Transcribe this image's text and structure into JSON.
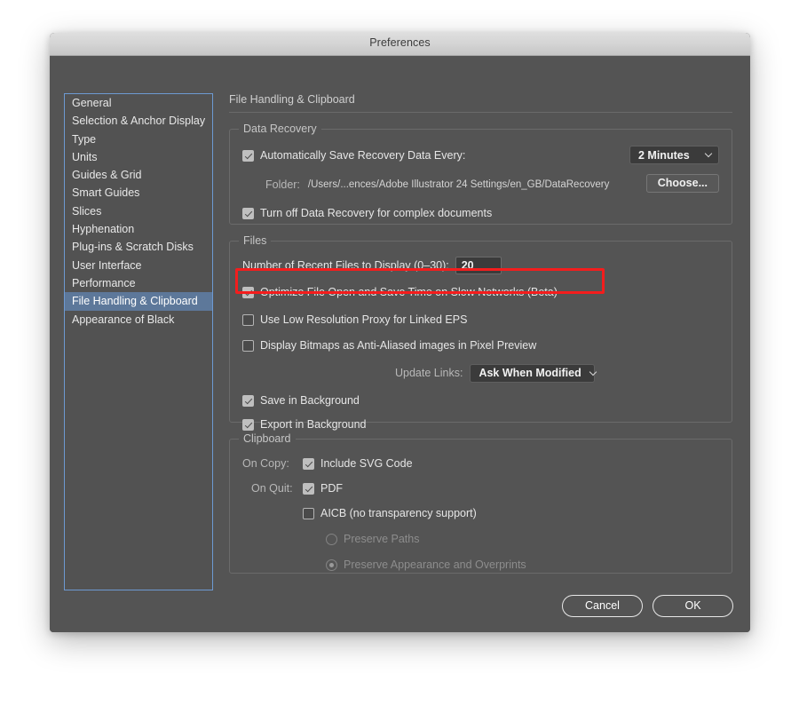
{
  "window": {
    "title": "Preferences"
  },
  "sidebar": {
    "items": [
      {
        "label": "General",
        "selected": false
      },
      {
        "label": "Selection & Anchor Display",
        "selected": false
      },
      {
        "label": "Type",
        "selected": false
      },
      {
        "label": "Units",
        "selected": false
      },
      {
        "label": "Guides & Grid",
        "selected": false
      },
      {
        "label": "Smart Guides",
        "selected": false
      },
      {
        "label": "Slices",
        "selected": false
      },
      {
        "label": "Hyphenation",
        "selected": false
      },
      {
        "label": "Plug-ins & Scratch Disks",
        "selected": false
      },
      {
        "label": "User Interface",
        "selected": false
      },
      {
        "label": "Performance",
        "selected": false
      },
      {
        "label": "File Handling & Clipboard",
        "selected": true
      },
      {
        "label": "Appearance of Black",
        "selected": false
      }
    ]
  },
  "panel": {
    "header": "File Handling & Clipboard",
    "data_recovery": {
      "title": "Data Recovery",
      "auto_save_label": "Automatically Save Recovery Data Every:",
      "auto_save_checked": true,
      "interval_value": "2 Minutes",
      "folder_label": "Folder:",
      "folder_path": "/Users/...ences/Adobe Illustrator 24 Settings/en_GB/DataRecovery",
      "choose_label": "Choose...",
      "turn_off_label": "Turn off Data Recovery for complex documents",
      "turn_off_checked": true
    },
    "files": {
      "title": "Files",
      "recent_files_label": "Number of Recent Files to Display (0–30):",
      "recent_files_value": "20",
      "optimize_label": "Optimize File Open and Save Time on Slow Networks (Beta)",
      "optimize_checked": true,
      "optimize_highlight_color": "#f41d1d",
      "low_res_proxy_label": "Use Low Resolution Proxy for Linked EPS",
      "low_res_proxy_checked": false,
      "bitmaps_label": "Display Bitmaps as Anti-Aliased images in Pixel Preview",
      "bitmaps_checked": false,
      "update_links_label": "Update Links:",
      "update_links_value": "Ask When Modified",
      "save_background_label": "Save in Background",
      "save_background_checked": true,
      "export_background_label": "Export in Background",
      "export_background_checked": true
    },
    "clipboard": {
      "title": "Clipboard",
      "on_copy_label": "On Copy:",
      "include_svg_label": "Include SVG Code",
      "include_svg_checked": true,
      "on_quit_label": "On Quit:",
      "pdf_label": "PDF",
      "pdf_checked": true,
      "aicb_label": "AICB (no transparency support)",
      "aicb_checked": false,
      "preserve_paths_label": "Preserve Paths",
      "preserve_paths_selected": false,
      "preserve_appearance_label": "Preserve Appearance and Overprints",
      "preserve_appearance_selected": true
    }
  },
  "footer": {
    "cancel_label": "Cancel",
    "ok_label": "OK"
  }
}
